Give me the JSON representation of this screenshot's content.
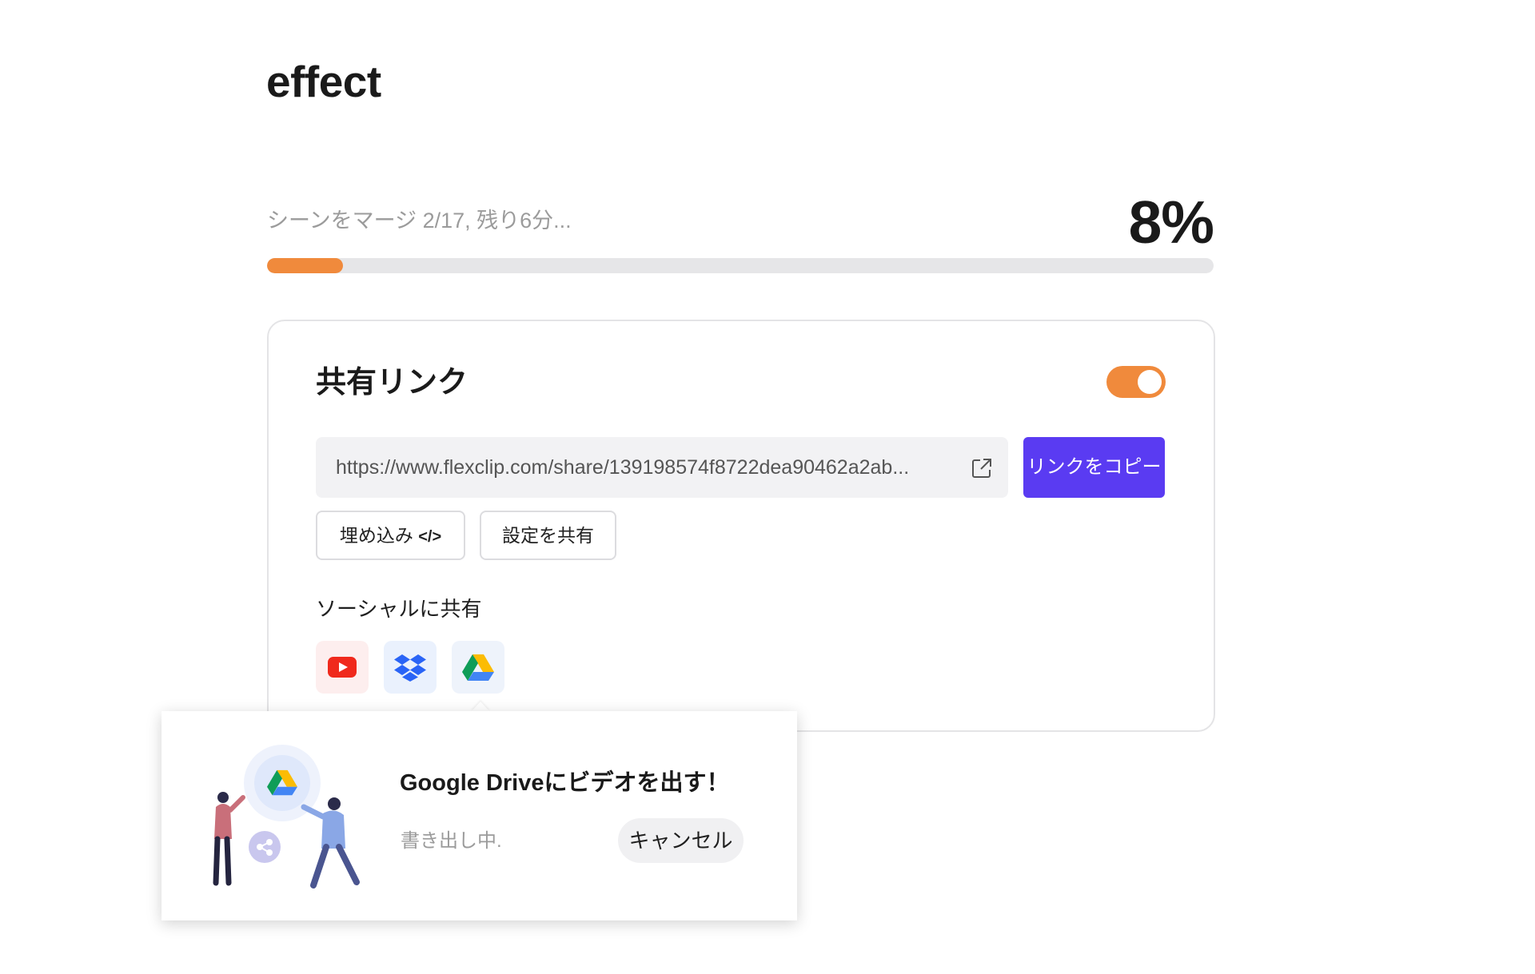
{
  "project": {
    "title": "effect"
  },
  "export": {
    "status_text": "シーンをマージ 2/17, 残り6分...",
    "percent_label": "8%",
    "progress_fraction": 0.08
  },
  "share": {
    "title": "共有リンク",
    "enabled": true,
    "url": "https://www.flexclip.com/share/139198574f8722dea90462a2ab...",
    "copy_label": "リンクをコピー",
    "embed_label": "埋め込み",
    "embed_code": "</>",
    "settings_label": "設定を共有",
    "social_label": "ソーシャルに共有",
    "social_icons": [
      "youtube-icon",
      "dropbox-icon",
      "google-drive-icon"
    ]
  },
  "gdrive_popup": {
    "title": "Google Driveにビデオを出す！",
    "status": "書き出し中.",
    "cancel_label": "キャンセル"
  },
  "colors": {
    "accent_orange": "#f08a3c",
    "primary_purple": "#5a3bf2"
  }
}
